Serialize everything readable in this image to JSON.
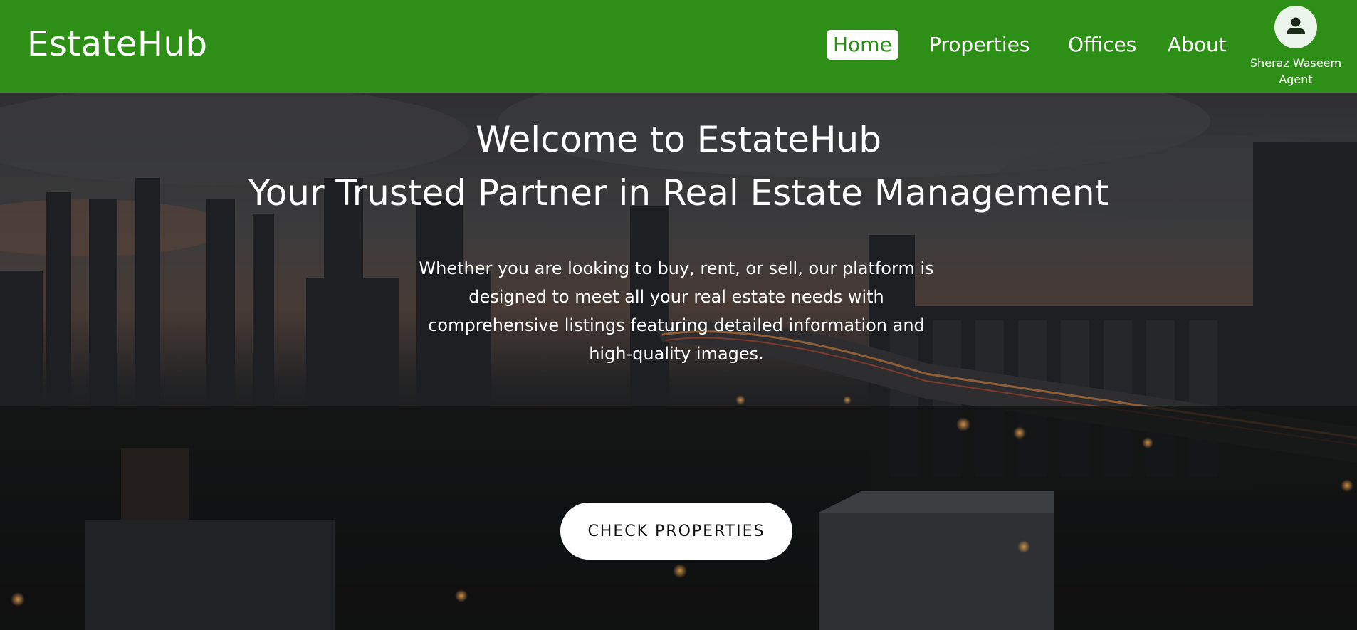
{
  "brand": "EstateHub",
  "nav": {
    "home": "Home",
    "properties": "Properties",
    "offices": "Offices",
    "about": "About"
  },
  "user": {
    "name": "Sheraz Waseem",
    "role": "Agent",
    "icon": "user-icon"
  },
  "hero": {
    "title_line1": "Welcome to EstateHub",
    "title_line2": "Your Trusted Partner in Real Estate Management",
    "description": "Whether you are looking to buy, rent, or sell, our platform is designed to meet all your real estate needs with comprehensive listings featuring detailed information and high-quality images.",
    "cta": "CHECK PROPERTIES"
  },
  "colors": {
    "navbar": "#2e8f16",
    "text": "#ffffff"
  }
}
